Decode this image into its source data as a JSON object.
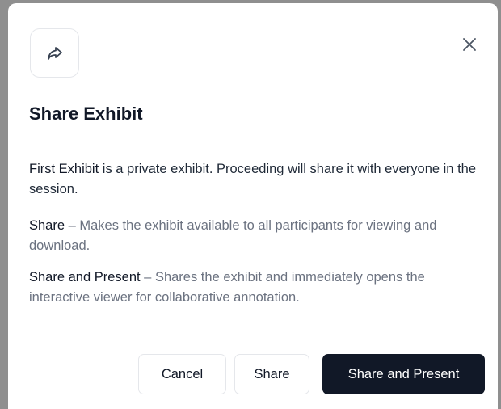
{
  "dialog": {
    "icon": "share-forward-icon",
    "close_icon": "close-icon",
    "title": "Share Exhibit",
    "intro": {
      "name": "First Exhibit",
      "text": " is a private exhibit. Proceeding will share it with everyone in the session."
    },
    "share_option": {
      "label": "Share",
      "text": " – Makes the exhibit available to all participants for viewing and download."
    },
    "present_option": {
      "label": "Share and Present",
      "text": " – Shares the exhibit and immediately opens the interactive viewer for collaborative annotation."
    },
    "buttons": {
      "cancel": "Cancel",
      "share": "Share",
      "share_and_present": "Share and Present"
    }
  }
}
